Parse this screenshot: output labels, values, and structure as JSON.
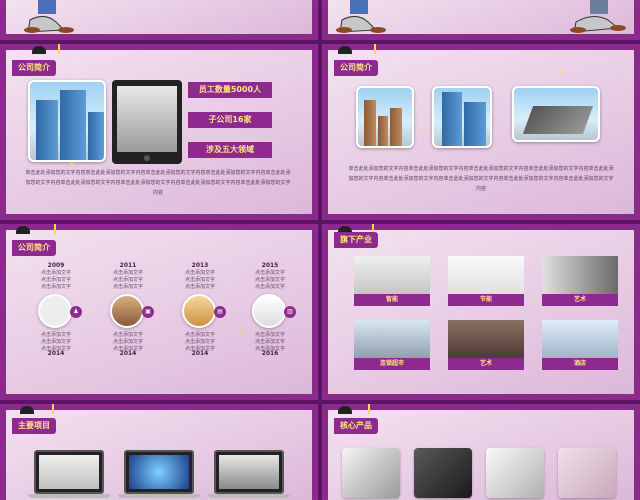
{
  "slide_company_1": {
    "title": "公司简介",
    "pills": [
      "员工数量5000人",
      "子公司16家",
      "涉及五大领域"
    ],
    "paragraph": "单击此处添加您的文字内容单击此处添加您的文字内容单击此处添加您的文字内容单击此处添加您的文字内容单击此处添加您的文字内容单击此处添加您的文字内容单击此处添加您的文字内容单击此处添加您的文字内容单击此处添加您的文字内容"
  },
  "slide_company_2": {
    "title": "公司简介",
    "paragraph": "单击此处添加您的文字内容单击此处添加您的文字内容单击此处添加您的文字内容单击此处添加您的文字内容单击此处添加您的文字内容单击此处添加您的文字内容单击此处添加您的文字内容单击此处添加您的文字内容单击此处添加您的文字内容"
  },
  "slide_timeline": {
    "title": "公司简介",
    "items": [
      {
        "top_year": "2009",
        "top_text": "点击添加文字\n点击添加文字\n点击添加文字",
        "bottom_text": "点击添加文字\n点击添加文字\n点击添加文字",
        "bottom_year": "2014"
      },
      {
        "top_year": "2011",
        "top_text": "点击添加文字\n点击添加文字\n点击添加文字",
        "bottom_text": "点击添加文字\n点击添加文字\n点击添加文字",
        "bottom_year": "2014"
      },
      {
        "top_year": "2013",
        "top_text": "点击添加文字\n点击添加文字\n点击添加文字",
        "bottom_text": "点击添加文字\n点击添加文字\n点击添加文字",
        "bottom_year": "2014"
      },
      {
        "top_year": "2015",
        "top_text": "点击添加文字\n点击添加文字\n点击添加文字",
        "bottom_text": "点击添加文字\n点击添加文字\n点击添加文字",
        "bottom_year": "2016"
      }
    ]
  },
  "slide_industry": {
    "title": "旗下产业",
    "tiles": [
      "智能",
      "节能",
      "艺术",
      "连锁超市",
      "艺术",
      "酒店"
    ]
  },
  "slide_projects": {
    "title": "主要项目"
  },
  "slide_products": {
    "title": "核心产品"
  },
  "colors": {
    "accent": "#8e2a8f",
    "title_text": "#ffe680",
    "background": "#ecd8ea"
  }
}
